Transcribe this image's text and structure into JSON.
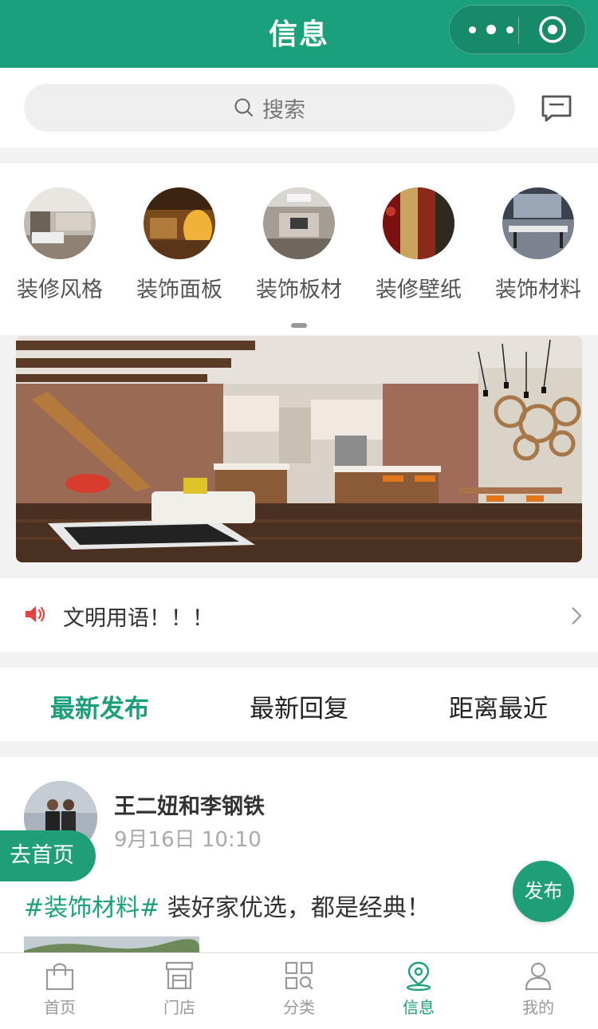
{
  "navbar": {
    "title": "信息"
  },
  "search": {
    "placeholder": "搜索"
  },
  "categories": [
    {
      "label": "装修风格"
    },
    {
      "label": "装饰面板"
    },
    {
      "label": "装饰板材"
    },
    {
      "label": "装修壁纸"
    },
    {
      "label": "装饰材料"
    }
  ],
  "notice": {
    "text": "文明用语！！！"
  },
  "tabs": [
    {
      "label": "最新发布"
    },
    {
      "label": "最新回复"
    },
    {
      "label": "距离最近"
    }
  ],
  "post": {
    "author": "王二妞和李钢铁",
    "time": "9月16日 10:10",
    "tag": "#装饰材料#",
    "text": " 装好家优选，都是经典！"
  },
  "floating": {
    "home": "去首页",
    "publish": "发布"
  },
  "tabbar": [
    {
      "label": "首页"
    },
    {
      "label": "门店"
    },
    {
      "label": "分类"
    },
    {
      "label": "信息"
    },
    {
      "label": "我的"
    }
  ],
  "colors": {
    "brand": "#1aa07a",
    "notice_icon": "#e64340"
  }
}
